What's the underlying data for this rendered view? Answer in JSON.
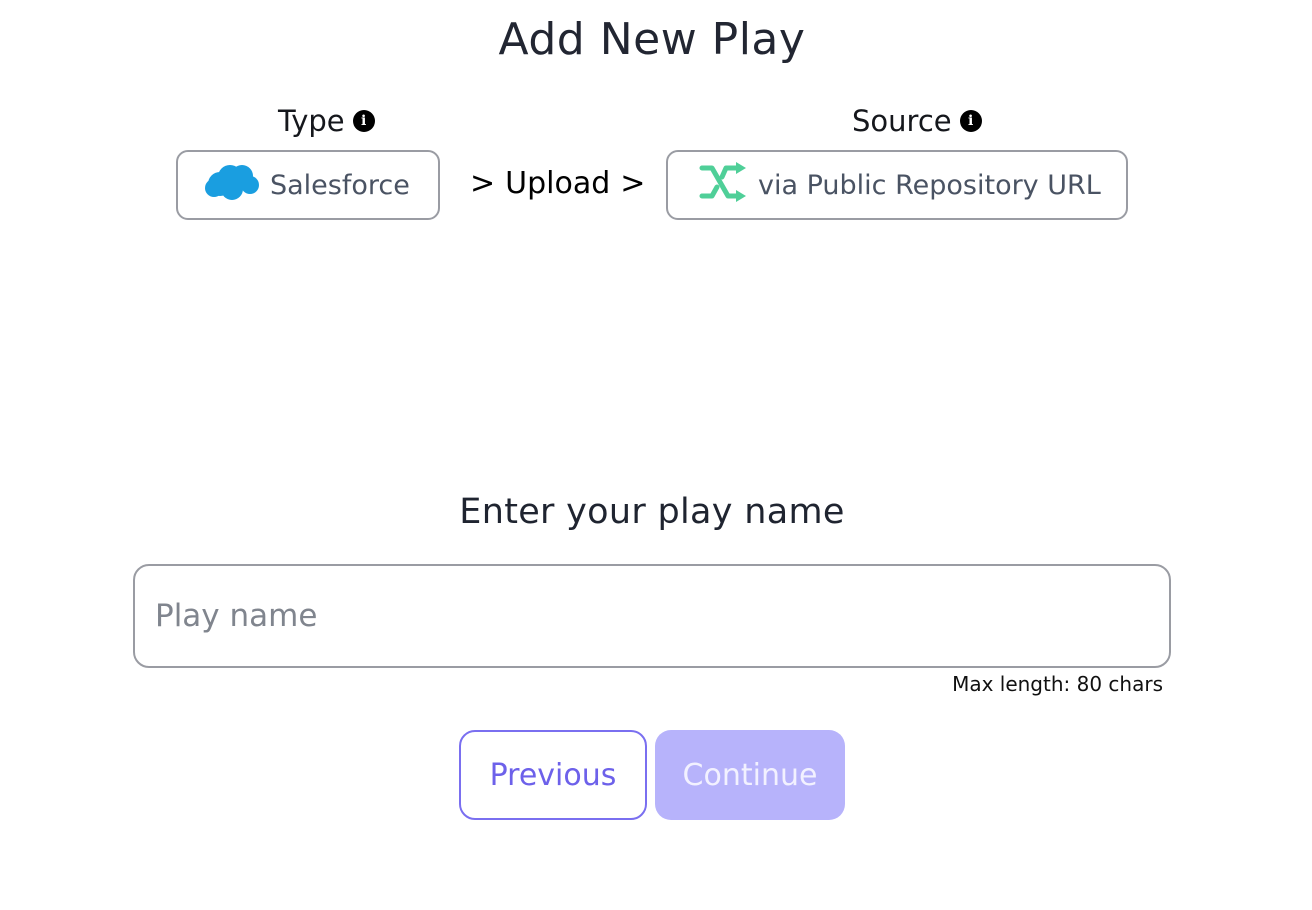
{
  "header": {
    "title": "Add New Play"
  },
  "steps": {
    "type_label": "Type",
    "source_label": "Source",
    "type_value": "Salesforce",
    "type_icon": "salesforce-cloud-icon",
    "upload_label": "Upload",
    "separator": ">",
    "source_value": "via Public Repository URL",
    "source_icon": "git-branch-merge-icon",
    "info_icon": "info-icon"
  },
  "form": {
    "prompt": "Enter your play name",
    "name_placeholder": "Play name",
    "name_value": "",
    "max_length_hint": "Max length: 80 chars"
  },
  "actions": {
    "previous_label": "Previous",
    "continue_label": "Continue"
  },
  "colors": {
    "accent": "#6d61ea",
    "accent_disabled": "#b7b3fb",
    "salesforce_blue": "#1a9ee0",
    "repo_green": "#4fcf98",
    "border": "#9a9ca3"
  }
}
